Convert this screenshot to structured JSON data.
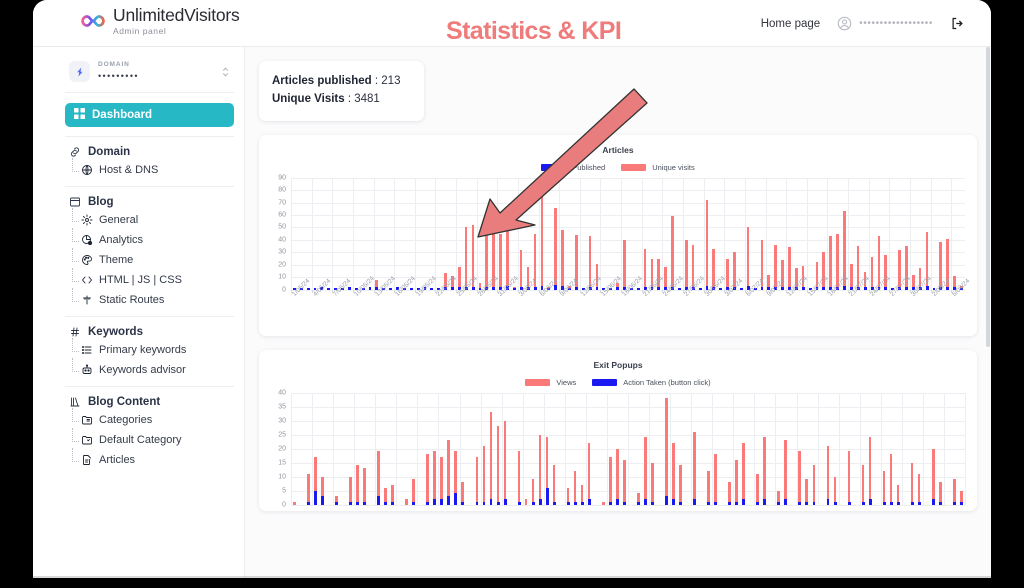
{
  "app": {
    "brand_name_part1": "Unlimited",
    "brand_name_part2": "Visitors",
    "brand_subtitle": "Admin panel",
    "logo_icon": "infinity-icon"
  },
  "header": {
    "home_link": "Home page",
    "avatar_icon": "user-circle-icon",
    "user_email_masked": "••••••••••••••••••",
    "logout_icon": "logout-icon"
  },
  "sidebar": {
    "domain_selector": {
      "label": "DOMAIN",
      "value_masked": "•••••••••",
      "icon": "domain-icon",
      "caret_icon": "chevron-up-down-icon"
    },
    "dashboard_button": {
      "label": "Dashboard",
      "icon": "grid-icon",
      "active_color": "#26b8c4"
    },
    "groups": [
      {
        "title": "Domain",
        "icon": "link-icon",
        "items": [
          {
            "label": "Host & DNS",
            "icon": "globe-icon"
          }
        ]
      },
      {
        "title": "Blog",
        "icon": "window-icon",
        "items": [
          {
            "label": "General",
            "icon": "gear-icon"
          },
          {
            "label": "Analytics",
            "icon": "analytics-icon"
          },
          {
            "label": "Theme",
            "icon": "palette-icon"
          },
          {
            "label": "HTML | JS | CSS",
            "icon": "code-icon"
          },
          {
            "label": "Static Routes",
            "icon": "route-icon"
          }
        ]
      },
      {
        "title": "Keywords",
        "icon": "hash-icon",
        "items": [
          {
            "label": "Primary keywords",
            "icon": "list-icon"
          },
          {
            "label": "Keywords advisor",
            "icon": "robot-icon"
          }
        ]
      },
      {
        "title": "Blog Content",
        "icon": "book-icon",
        "items": [
          {
            "label": "Categories",
            "icon": "folder-icon"
          },
          {
            "label": "Default Category",
            "icon": "folder-star-icon"
          },
          {
            "label": "Articles",
            "icon": "document-edit-icon"
          }
        ]
      }
    ]
  },
  "main": {
    "kpi_title": "Statistics & KPI",
    "kpi_title_color": "#ef7b7b",
    "arrow_color": "#e97c7c",
    "stats_card": [
      {
        "label": "Articles published",
        "separator": " : ",
        "value": "213"
      },
      {
        "label": "Unique Visits",
        "separator": " : ",
        "value": "3481"
      }
    ]
  },
  "chart_data": [
    {
      "type": "bar",
      "title": "Articles",
      "xlabel": "",
      "ylabel": "",
      "ylim": [
        0,
        90
      ],
      "yticks": [
        0,
        10,
        20,
        30,
        40,
        50,
        60,
        70,
        80,
        90
      ],
      "grid": true,
      "legend_position": "top",
      "legend": [
        {
          "name": "Published",
          "color": "#1a1af0"
        },
        {
          "name": "Unique visits",
          "color": "#fa7a7a"
        }
      ],
      "x_tick_labels": [
        "1/05/24",
        "4/05/24",
        "7/05/24",
        "10/05/24",
        "13/05/24",
        "16/05/24",
        "19/05/24",
        "22/05/24",
        "25/05/24",
        "28/05/24",
        "31/05/24",
        "3/06/24",
        "6/06/24",
        "9/06/24",
        "12/06/24",
        "15/06/24",
        "18/06/24",
        "21/06/24",
        "24/06/24",
        "27/06/24",
        "30/06/24",
        "3/07/24",
        "6/07/24",
        "9/07/24",
        "12/07/24",
        "15/07/24",
        "18/07/24",
        "21/07/24",
        "24/07/24",
        "27/07/24",
        "30/07/24",
        "2/08/24",
        "5/08/24"
      ],
      "x_tick_every": 3,
      "series": [
        {
          "name": "Unique visits",
          "color": "#fa7a7a",
          "values": [
            1,
            0,
            0,
            0,
            1,
            0,
            0,
            0,
            1,
            0,
            0,
            1,
            8,
            0,
            0,
            1,
            0,
            0,
            0,
            1,
            0,
            0,
            13,
            11,
            18,
            50,
            52,
            5,
            48,
            46,
            45,
            49,
            2,
            32,
            18,
            45,
            85,
            2,
            66,
            48,
            3,
            44,
            0,
            43,
            21,
            0,
            0,
            5,
            40,
            0,
            0,
            33,
            25,
            25,
            18,
            59,
            0,
            40,
            36,
            0,
            72,
            33,
            0,
            25,
            30,
            0,
            50,
            0,
            40,
            12,
            36,
            24,
            34,
            17,
            19,
            0,
            22,
            30,
            43,
            45,
            63,
            21,
            35,
            14,
            26,
            43,
            28,
            0,
            32,
            35,
            12,
            17,
            46,
            0,
            38,
            41,
            11,
            3
          ]
        },
        {
          "name": "Published",
          "color": "#1a1af0",
          "values": [
            1,
            1,
            1,
            1,
            2,
            1,
            1,
            1,
            2,
            1,
            1,
            2,
            2,
            1,
            1,
            2,
            1,
            1,
            1,
            2,
            1,
            1,
            2,
            2,
            2,
            2,
            2,
            1,
            2,
            2,
            2,
            3,
            1,
            2,
            2,
            2,
            3,
            1,
            4,
            3,
            1,
            2,
            1,
            2,
            2,
            1,
            1,
            2,
            2,
            1,
            1,
            2,
            2,
            2,
            2,
            2,
            1,
            2,
            2,
            1,
            3,
            2,
            1,
            2,
            2,
            1,
            3,
            1,
            2,
            2,
            2,
            2,
            2,
            2,
            2,
            1,
            2,
            2,
            2,
            2,
            3,
            2,
            2,
            2,
            2,
            2,
            2,
            1,
            2,
            2,
            2,
            2,
            3,
            1,
            2,
            2,
            2,
            1
          ]
        }
      ]
    },
    {
      "type": "bar",
      "title": "Exit Popups",
      "xlabel": "",
      "ylabel": "",
      "ylim": [
        0,
        40
      ],
      "yticks": [
        0,
        5,
        10,
        15,
        20,
        25,
        30,
        35,
        40
      ],
      "grid": true,
      "legend_position": "top",
      "legend": [
        {
          "name": "Views",
          "color": "#fa7a7a"
        },
        {
          "name": "Action Taken (button click)",
          "color": "#1a1af0"
        }
      ],
      "series": [
        {
          "name": "Views",
          "color": "#fa7a7a",
          "values": [
            1,
            0,
            11,
            17,
            10,
            0,
            3,
            0,
            10,
            14,
            13,
            0,
            19,
            6,
            7,
            0,
            2,
            9,
            0,
            18,
            19,
            17,
            23,
            19,
            8,
            0,
            17,
            21,
            33,
            28,
            30,
            0,
            19,
            2,
            9,
            25,
            24,
            14,
            0,
            6,
            12,
            7,
            22,
            0,
            1,
            17,
            20,
            16,
            0,
            4,
            24,
            15,
            0,
            38,
            22,
            14,
            0,
            26,
            0,
            12,
            18,
            0,
            8,
            16,
            22,
            0,
            11,
            24,
            0,
            5,
            23,
            0,
            19,
            9,
            14,
            0,
            21,
            10,
            0,
            19,
            0,
            14,
            24,
            0,
            12,
            18,
            7,
            0,
            15,
            11,
            0,
            20,
            8,
            0,
            9,
            5
          ]
        },
        {
          "name": "Action Taken (button click)",
          "color": "#1a1af0",
          "values": [
            0,
            0,
            1,
            5,
            3,
            0,
            1,
            0,
            1,
            1,
            1,
            0,
            3,
            1,
            1,
            0,
            0,
            1,
            0,
            1,
            2,
            2,
            3,
            4,
            1,
            0,
            1,
            1,
            2,
            1,
            2,
            0,
            1,
            0,
            1,
            2,
            6,
            1,
            0,
            1,
            1,
            1,
            2,
            0,
            0,
            1,
            2,
            1,
            0,
            1,
            2,
            1,
            0,
            3,
            2,
            1,
            0,
            2,
            0,
            1,
            1,
            0,
            1,
            1,
            2,
            0,
            1,
            2,
            0,
            1,
            2,
            0,
            1,
            1,
            1,
            0,
            2,
            1,
            0,
            1,
            0,
            1,
            2,
            0,
            1,
            1,
            1,
            0,
            1,
            1,
            0,
            2,
            1,
            0,
            1,
            1
          ]
        }
      ]
    }
  ]
}
